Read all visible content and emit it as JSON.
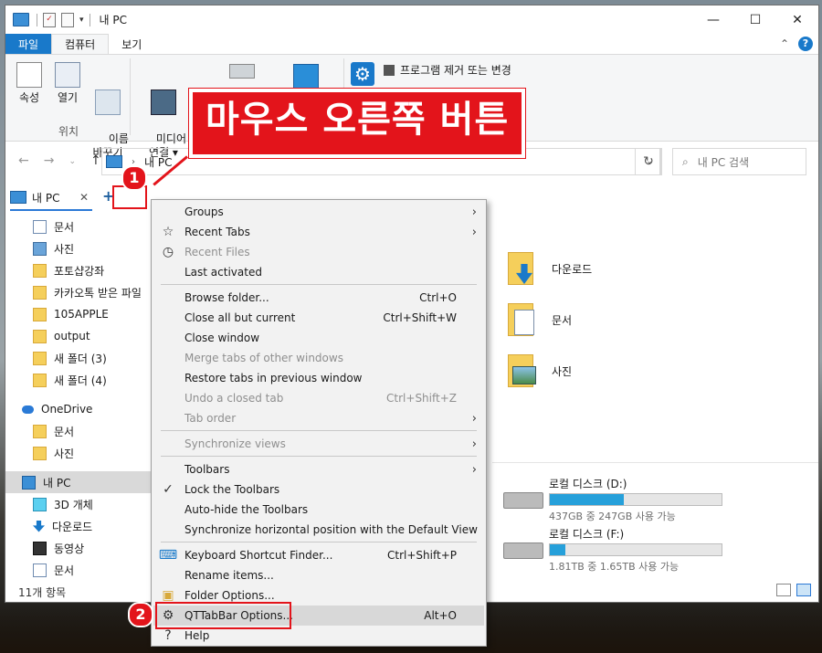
{
  "window": {
    "title": "내 PC",
    "controls": {
      "minimize": "—",
      "maximize": "☐",
      "close": "✕"
    }
  },
  "ribbon_tabs": [
    "파일",
    "컴퓨터",
    "보기"
  ],
  "ribbon": {
    "groups": [
      {
        "label": "위치",
        "buttons": [
          "속성",
          "열기",
          "이름\n바꾸기"
        ]
      }
    ],
    "media_button": "미디어 서버\n연결 ▾",
    "uninstall": "프로그램 제거 또는 변경"
  },
  "address": {
    "path": "내 PC",
    "search_placeholder": "내 PC 검색"
  },
  "tab": {
    "label": "내 PC",
    "close": "✕",
    "new_tab": "+"
  },
  "sidebar": {
    "items": [
      {
        "label": "문서",
        "icon": "doc"
      },
      {
        "label": "사진",
        "icon": "pic"
      },
      {
        "label": "포토샵강좌",
        "icon": "folder"
      },
      {
        "label": "카카오톡 받은 파일",
        "icon": "folder"
      },
      {
        "label": "105APPLE",
        "icon": "folder"
      },
      {
        "label": "output",
        "icon": "folder"
      },
      {
        "label": "새 폴더 (3)",
        "icon": "folder"
      },
      {
        "label": "새 폴더 (4)",
        "icon": "folder"
      },
      {
        "label": "OneDrive",
        "icon": "cloud"
      },
      {
        "label": "문서",
        "icon": "folder"
      },
      {
        "label": "사진",
        "icon": "folder"
      },
      {
        "label": "내 PC",
        "icon": "pc"
      },
      {
        "label": "3D 개체",
        "icon": "cube"
      },
      {
        "label": "다운로드",
        "icon": "down"
      },
      {
        "label": "동영상",
        "icon": "film"
      },
      {
        "label": "문서",
        "icon": "doc"
      }
    ]
  },
  "status": {
    "count": "11개 항목"
  },
  "folders": [
    {
      "label": "다운로드"
    },
    {
      "label": "문서"
    },
    {
      "label": "사진"
    }
  ],
  "drives": [
    {
      "name": "로컬 디스크 (D:)",
      "info": "437GB 중 247GB 사용 가능",
      "used_fraction": 0.43
    },
    {
      "name": "로컬 디스크 (F:)",
      "info": "1.81TB 중 1.65TB 사용 가능",
      "used_fraction": 0.09
    }
  ],
  "menu": {
    "items": [
      {
        "label": "Groups",
        "shortcut": "",
        "submenu": true,
        "icon": "",
        "disabled": false
      },
      {
        "label": "Recent Tabs",
        "shortcut": "",
        "submenu": true,
        "icon": "star",
        "disabled": false
      },
      {
        "label": "Recent Files",
        "shortcut": "",
        "submenu": false,
        "icon": "clock",
        "disabled": true
      },
      {
        "label": "Last activated",
        "shortcut": "",
        "submenu": false,
        "icon": "",
        "disabled": false
      },
      {
        "label": "Browse folder...",
        "shortcut": "Ctrl+O",
        "submenu": false,
        "icon": "",
        "disabled": false
      },
      {
        "label": "Close all but current",
        "shortcut": "Ctrl+Shift+W",
        "submenu": false,
        "icon": "",
        "disabled": false
      },
      {
        "label": "Close window",
        "shortcut": "",
        "submenu": false,
        "icon": "",
        "disabled": false
      },
      {
        "label": "Merge tabs of other windows",
        "shortcut": "",
        "submenu": false,
        "icon": "",
        "disabled": true
      },
      {
        "label": "Restore tabs in previous window",
        "shortcut": "",
        "submenu": false,
        "icon": "",
        "disabled": false
      },
      {
        "label": "Undo a closed tab",
        "shortcut": "Ctrl+Shift+Z",
        "submenu": false,
        "icon": "",
        "disabled": true
      },
      {
        "label": "Tab order",
        "shortcut": "",
        "submenu": true,
        "icon": "",
        "disabled": true
      },
      {
        "label": "Synchronize views",
        "shortcut": "",
        "submenu": true,
        "icon": "",
        "disabled": true
      },
      {
        "label": "Toolbars",
        "shortcut": "",
        "submenu": true,
        "icon": "",
        "disabled": false
      },
      {
        "label": "Lock the Toolbars",
        "shortcut": "",
        "submenu": false,
        "icon": "check",
        "disabled": false
      },
      {
        "label": "Auto-hide the Toolbars",
        "shortcut": "",
        "submenu": false,
        "icon": "",
        "disabled": false
      },
      {
        "label": "Synchronize horizontal position with the Default View",
        "shortcut": "",
        "submenu": false,
        "icon": "",
        "disabled": false
      },
      {
        "label": "Keyboard Shortcut Finder...",
        "shortcut": "Ctrl+Shift+P",
        "submenu": false,
        "icon": "keyboard",
        "disabled": false
      },
      {
        "label": "Rename items...",
        "shortcut": "",
        "submenu": false,
        "icon": "",
        "disabled": false
      },
      {
        "label": "Folder Options...",
        "shortcut": "",
        "submenu": false,
        "icon": "folder",
        "disabled": false
      },
      {
        "label": "QTTabBar Options...",
        "shortcut": "Alt+O",
        "submenu": false,
        "icon": "gear",
        "disabled": false,
        "highlighted": true
      },
      {
        "label": "Help",
        "shortcut": "",
        "submenu": false,
        "icon": "help",
        "disabled": false
      }
    ]
  },
  "annotations": {
    "callout": "마우스 오른쪽 버튼",
    "badge1": "1",
    "badge2": "2",
    "color": "#e3141b"
  }
}
